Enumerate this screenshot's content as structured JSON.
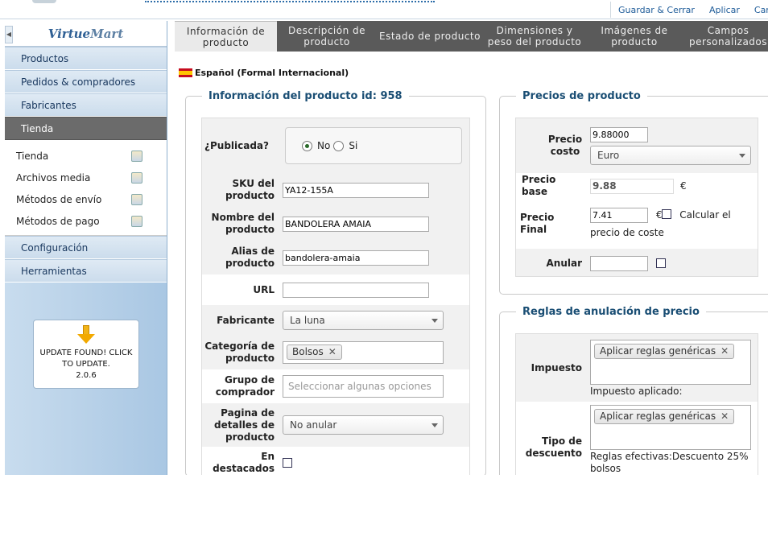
{
  "toolbar": {
    "save_close": "Guardar & Cerrar",
    "apply": "Aplicar",
    "cancel": "Cancela"
  },
  "sidebar": {
    "logo": "VirtueMart",
    "items": [
      {
        "label": "Productos"
      },
      {
        "label": "Pedidos & compradores"
      },
      {
        "label": "Fabricantes"
      },
      {
        "label": "Tienda"
      }
    ],
    "subitems": [
      {
        "label": "Tienda"
      },
      {
        "label": "Archivos media"
      },
      {
        "label": "Métodos de envío"
      },
      {
        "label": "Métodos de pago"
      }
    ],
    "items_after": [
      {
        "label": "Configuración"
      },
      {
        "label": "Herramientas"
      }
    ],
    "update": {
      "line1": "UPDATE FOUND! CLICK",
      "line2": "TO UPDATE.",
      "version": "2.0.6"
    }
  },
  "tabs": [
    {
      "line1": "Información de",
      "line2": "producto"
    },
    {
      "line1": "Descripción de",
      "line2": "producto"
    },
    {
      "line1": "Estado de producto",
      "line2": ""
    },
    {
      "line1": "Dimensiones y",
      "line2": "peso del producto"
    },
    {
      "line1": "Imágenes de",
      "line2": "producto"
    },
    {
      "line1": "Campos",
      "line2": "personalizados"
    }
  ],
  "language": "Español (Formal Internacional)",
  "info": {
    "legend": "Información del producto id: 958",
    "published": {
      "label": "¿Publicada?",
      "no": "No",
      "yes": "Si"
    },
    "sku": {
      "l1": "SKU del",
      "l2": "producto",
      "value": "YA12-155A"
    },
    "name": {
      "l1": "Nombre del",
      "l2": "producto",
      "value": "BANDOLERA AMAIA"
    },
    "alias": {
      "l1": "Alias de",
      "l2": "producto",
      "value": "bandolera-amaia"
    },
    "url": {
      "label": "URL",
      "value": ""
    },
    "manufacturer": {
      "label": "Fabricante",
      "value": "La luna"
    },
    "category": {
      "l1": "Categoría de",
      "l2": "producto",
      "chip": "Bolsos"
    },
    "group": {
      "l1": "Grupo de",
      "l2": "comprador",
      "placeholder": "Seleccionar algunas opciones"
    },
    "detail_page": {
      "l1": "Pagina de",
      "l2": "detalles de",
      "l3": "producto",
      "value": "No anular"
    },
    "featured": {
      "l1": "En",
      "l2": "destacados"
    }
  },
  "prices": {
    "legend": "Precios de producto",
    "cost": {
      "l1": "Precio",
      "l2": "costo",
      "value": "9.88000",
      "currency": "Euro"
    },
    "base": {
      "label": "Precio base",
      "value": "9.88",
      "symbol": "€"
    },
    "final": {
      "label": "Precio Final",
      "value": "7.41",
      "symbol": "€",
      "calc_label": "Calcular el",
      "calc_label2": "precio de coste"
    },
    "override": {
      "label": "Anular",
      "value": ""
    }
  },
  "rules": {
    "legend": "Reglas de anulación de precio",
    "tax": {
      "label": "Impuesto",
      "chip": "Aplicar reglas genéricas",
      "note": "Impuesto aplicado:"
    },
    "discount": {
      "l1": "Tipo de",
      "l2": "descuento",
      "chip": "Aplicar reglas genéricas",
      "note": "Reglas efectivas:Descuento 25%",
      "note2": "bolsos"
    }
  }
}
